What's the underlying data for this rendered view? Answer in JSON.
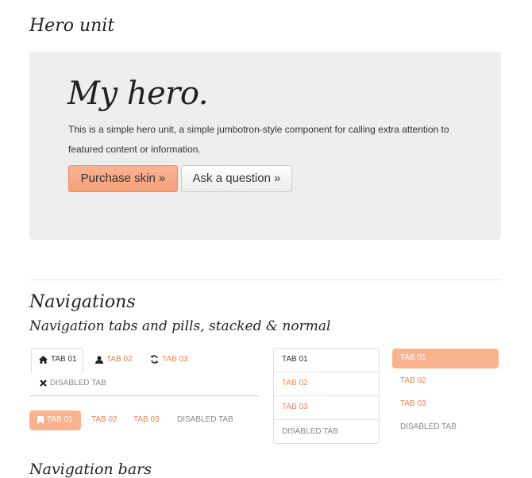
{
  "hero_section": {
    "heading": "Hero unit",
    "title": "My hero.",
    "text": "This is a simple hero unit, a simple jumbotron-style component for calling extra attention to featured content or information.",
    "primary_button": "Purchase skin »",
    "secondary_button": "Ask a question »"
  },
  "navigations": {
    "heading": "Navigations",
    "subheading": "Navigation tabs and pills, stacked & normal",
    "tabs": [
      {
        "label": "TAB 01",
        "icon": "home-icon",
        "state": "active"
      },
      {
        "label": "TAB 02",
        "icon": "user-icon",
        "state": "normal"
      },
      {
        "label": "TAB 03",
        "icon": "refresh-icon",
        "state": "normal"
      },
      {
        "label": "DISABLED TAB",
        "icon": "close-icon",
        "state": "disabled"
      }
    ],
    "pills": [
      {
        "label": "TAB 01",
        "icon": "bookmark-icon",
        "state": "active"
      },
      {
        "label": "TAB 02",
        "state": "normal"
      },
      {
        "label": "TAB 03",
        "state": "normal"
      },
      {
        "label": "DISABLED TAB",
        "state": "disabled"
      }
    ],
    "stacked_tabs": [
      {
        "label": "TAB 01",
        "state": "active"
      },
      {
        "label": "TAB 02",
        "state": "normal"
      },
      {
        "label": "TAB 03",
        "state": "normal"
      },
      {
        "label": "DISABLED TAB",
        "state": "disabled"
      }
    ],
    "stacked_pills": [
      {
        "label": "TAB 01",
        "state": "active"
      },
      {
        "label": "TAB 02",
        "state": "normal"
      },
      {
        "label": "TAB 03",
        "state": "normal"
      },
      {
        "label": "DISABLED TAB",
        "state": "disabled"
      }
    ]
  },
  "navbars": {
    "heading": "Navigation bars"
  },
  "colors": {
    "accent": "#e8855b",
    "active_pill": "#fab38f",
    "hero_bg": "#eeeeee"
  }
}
